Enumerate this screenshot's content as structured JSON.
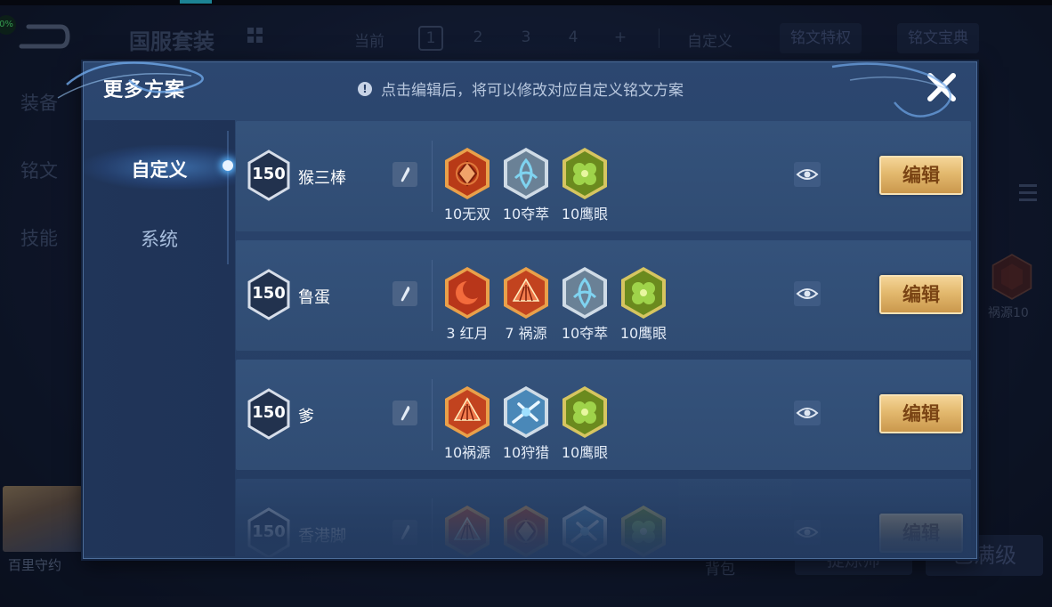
{
  "overlay_percent": "0%",
  "background": {
    "title": "国服套装",
    "current_label": "当前",
    "pages": [
      "1",
      "2",
      "3",
      "4",
      "+"
    ],
    "custom_label": "自定义",
    "rune_special_btn": "铭文特权",
    "rune_book_btn": "铭文宝典",
    "side_tabs": [
      "装备",
      "铭文",
      "技能"
    ],
    "hero_name": "百里守约",
    "bag_label": "背包",
    "right_rune_label": "祸源10",
    "upgrade_btn": "已满级",
    "teach_btn": "提炼师"
  },
  "modal": {
    "title": "更多方案",
    "hint": "点击编辑后，将可以修改对应自定义铭文方案",
    "hint_icon": "!",
    "sidebar": [
      {
        "label": "自定义",
        "active": true
      },
      {
        "label": "系统",
        "active": false
      }
    ],
    "plans": [
      {
        "level": "150",
        "name": "猴三棒",
        "runes": [
          {
            "label": "10无双",
            "kind": "red-diamond"
          },
          {
            "label": "10夺萃",
            "kind": "silver-knot"
          },
          {
            "label": "10鹰眼",
            "kind": "green-clover"
          }
        ],
        "edit_label": "编辑"
      },
      {
        "level": "150",
        "name": "鲁蛋",
        "runes": [
          {
            "label": "3 红月",
            "kind": "red-moon"
          },
          {
            "label": "7 祸源",
            "kind": "red-fan"
          },
          {
            "label": "10夺萃",
            "kind": "silver-knot"
          },
          {
            "label": "10鹰眼",
            "kind": "green-clover"
          }
        ],
        "edit_label": "编辑"
      },
      {
        "level": "150",
        "name": "爹",
        "runes": [
          {
            "label": "10祸源",
            "kind": "red-fan"
          },
          {
            "label": "10狩猎",
            "kind": "blue-arrow"
          },
          {
            "label": "10鹰眼",
            "kind": "green-clover"
          }
        ],
        "edit_label": "编辑"
      },
      {
        "level": "150",
        "name": "香港脚",
        "runes": [
          {
            "label": "",
            "kind": "red-fan"
          },
          {
            "label": "",
            "kind": "red-diamond"
          },
          {
            "label": "",
            "kind": "blue-arrow"
          },
          {
            "label": "",
            "kind": "green-clover"
          }
        ],
        "edit_label": "编辑"
      }
    ]
  },
  "colors": {
    "modal_bg": "#2a456d",
    "card_bg": "#34527b",
    "edit_gold": "#e3b96e",
    "active_glow": "#5ab6ff"
  }
}
